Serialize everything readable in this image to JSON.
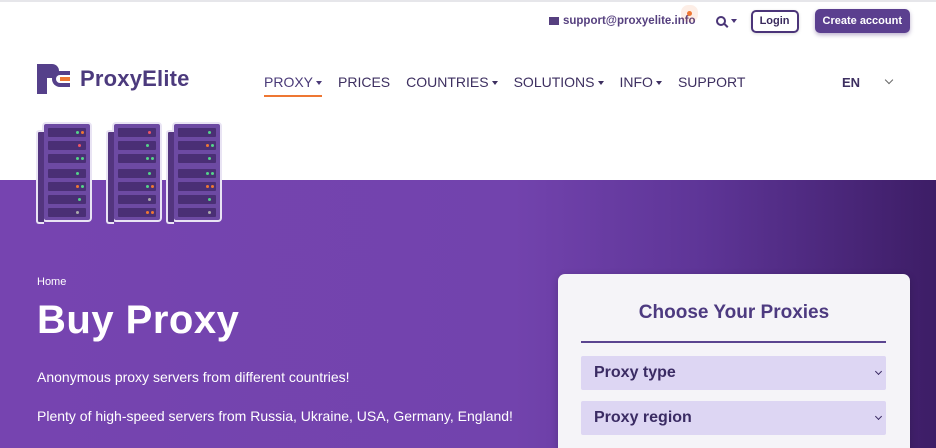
{
  "header": {
    "email": "support@proxyelite.info",
    "login_label": "Login",
    "create_label": "Create account"
  },
  "logo": {
    "text": "ProxyElite"
  },
  "nav": {
    "items": [
      {
        "label": "PROXY",
        "dropdown": true,
        "active": true
      },
      {
        "label": "PRICES",
        "dropdown": false
      },
      {
        "label": "COUNTRIES",
        "dropdown": true
      },
      {
        "label": "SOLUTIONS",
        "dropdown": true
      },
      {
        "label": "INFO",
        "dropdown": true
      },
      {
        "label": "SUPPORT",
        "dropdown": false
      }
    ],
    "language": "EN"
  },
  "hero": {
    "breadcrumb": "Home",
    "title": "Buy Proxy",
    "line1": "Anonymous proxy servers from different countries!",
    "line2": "Plenty of high-speed servers from Russia, Ukraine, USA, Germany, England!"
  },
  "card": {
    "title": "Choose Your Proxies",
    "proxy_type": "Proxy type",
    "proxy_region": "Proxy region"
  },
  "colors": {
    "brand": "#5b3f8f",
    "accent": "#ee7733",
    "hero_start": "#7644b0",
    "hero_end": "#3d1d66"
  },
  "icons": [
    "envelope-icon",
    "search-icon",
    "chevron-down-icon",
    "server-illustration"
  ]
}
